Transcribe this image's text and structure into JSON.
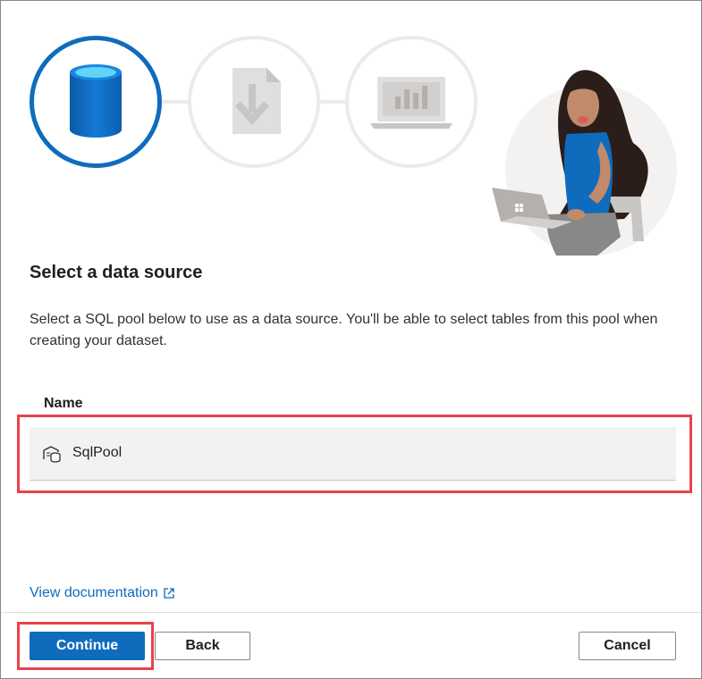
{
  "wizard": {
    "steps": [
      {
        "icon": "database-icon",
        "state": "active"
      },
      {
        "icon": "download-file-icon",
        "state": "inactive"
      },
      {
        "icon": "laptop-chart-icon",
        "state": "inactive"
      }
    ],
    "accent_color": "#0f6cbd"
  },
  "content": {
    "heading": "Select a data source",
    "description": "Select a SQL pool below to use as a data source. You'll be able to select tables from this pool when creating your dataset.",
    "table": {
      "column_header": "Name",
      "rows": [
        {
          "icon": "sql-pool-icon",
          "label": "SqlPool"
        }
      ]
    },
    "doc_link": "View documentation"
  },
  "footer": {
    "continue_label": "Continue",
    "back_label": "Back",
    "cancel_label": "Cancel"
  },
  "annotation_color": "#e8424a"
}
